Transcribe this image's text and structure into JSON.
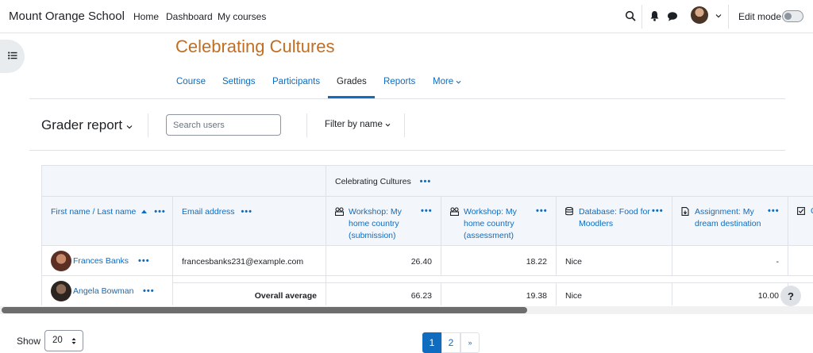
{
  "navbar": {
    "brand": "Mount Orange School",
    "links": [
      "Home",
      "Dashboard",
      "My courses"
    ],
    "edit_mode_label": "Edit mode",
    "icons": [
      "search-icon",
      "bell-icon",
      "chat-icon",
      "user-avatar",
      "chevron-down-icon"
    ]
  },
  "course": {
    "title": "Celebrating Cultures",
    "title_color": "#c16e22",
    "tabs": [
      "Course",
      "Settings",
      "Participants",
      "Grades",
      "Reports",
      "More"
    ],
    "active_tab": "Grades"
  },
  "toolbar": {
    "report_selector": "Grader report",
    "search_placeholder": "Search users",
    "filter_label": "Filter by name"
  },
  "grader": {
    "category_header": "Celebrating Cultures",
    "columns": [
      {
        "label": "First name / Last name",
        "icon": "sort-asc-icon"
      },
      {
        "label": "Email address",
        "icon": ""
      },
      {
        "label": "Workshop: My home country (submission)",
        "icon": "workshop-icon"
      },
      {
        "label": "Workshop: My home country (assessment)",
        "icon": "workshop-icon"
      },
      {
        "label": "Database: Food for Moodlers",
        "icon": "database-icon"
      },
      {
        "label": "Assignment: My dream destination",
        "icon": "assignment-icon"
      },
      {
        "label": "C",
        "icon": "checkbox-icon"
      }
    ],
    "rows": [
      {
        "name": "Frances Banks",
        "email": "francesbanks231@example.com",
        "values": [
          "26.40",
          "18.22",
          "Nice",
          "-"
        ]
      },
      {
        "name": "Angela Bowman",
        "email": "",
        "values": []
      }
    ],
    "overall": {
      "label": "Overall average",
      "values": [
        "66.23",
        "19.38",
        "Nice",
        "10.00"
      ]
    }
  },
  "help_label": "?",
  "pagination": {
    "show_label": "Show",
    "page_size": "20",
    "pages": [
      "1",
      "2",
      "»"
    ],
    "active_page": "1"
  },
  "colors": {
    "link": "#0f6cbf",
    "header_bg": "#f3f6fa",
    "border": "#dee2e6"
  }
}
